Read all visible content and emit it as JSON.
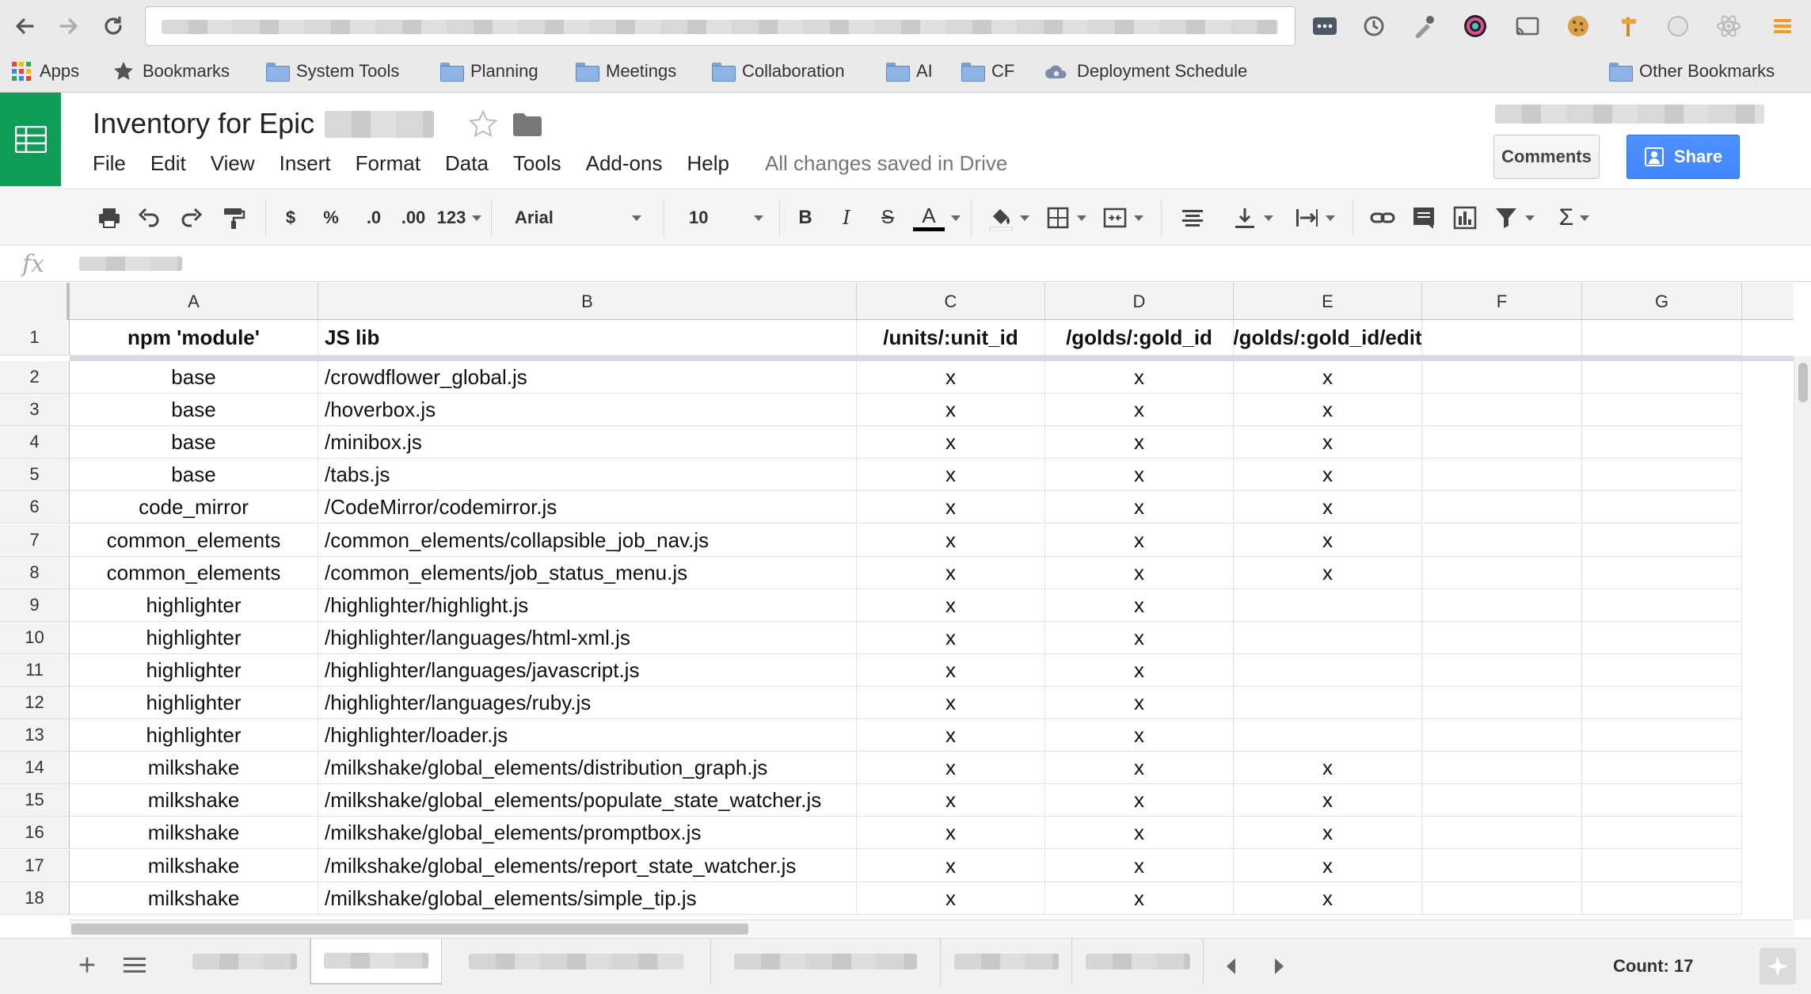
{
  "browser": {
    "bookmarks": [
      {
        "label": "Apps",
        "icon": "apps-grid-icon"
      },
      {
        "label": "Bookmarks",
        "icon": "star-icon"
      },
      {
        "label": "System Tools",
        "icon": "folder-icon"
      },
      {
        "label": "Planning",
        "icon": "folder-icon"
      },
      {
        "label": "Meetings",
        "icon": "folder-icon"
      },
      {
        "label": "Collaboration",
        "icon": "folder-icon"
      },
      {
        "label": "AI",
        "icon": "folder-icon"
      },
      {
        "label": "CF",
        "icon": "folder-icon"
      },
      {
        "label": "Deployment Schedule",
        "icon": "cloud-gear-icon"
      }
    ],
    "other_bookmarks": "Other Bookmarks"
  },
  "doc": {
    "title": "Inventory for Epic",
    "menu": [
      "File",
      "Edit",
      "View",
      "Insert",
      "Format",
      "Data",
      "Tools",
      "Add-ons",
      "Help"
    ],
    "save_status": "All changes saved in Drive",
    "comments_label": "Comments",
    "share_label": "Share"
  },
  "toolbar": {
    "currency": "$",
    "percent": "%",
    "dec_decrease": ".0",
    "dec_increase": ".00",
    "more_formats": "123",
    "font": "Arial",
    "font_size": "10",
    "bold": "B",
    "italic": "I",
    "strike": "S",
    "text_color": "A",
    "sum": "Σ"
  },
  "formula_bar": {
    "fx": "fx"
  },
  "grid": {
    "columns": [
      "A",
      "B",
      "C",
      "D",
      "E",
      "F",
      "G"
    ],
    "header_row": {
      "num": "1",
      "cells": [
        "npm 'module'",
        "JS lib",
        "/units/:unit_id",
        "/golds/:gold_id",
        "/golds/:gold_id/edit",
        "",
        ""
      ]
    },
    "rows": [
      {
        "num": "2",
        "cells": [
          "base",
          "/crowdflower_global.js",
          "x",
          "x",
          "x",
          "",
          ""
        ]
      },
      {
        "num": "3",
        "cells": [
          "base",
          "/hoverbox.js",
          "x",
          "x",
          "x",
          "",
          ""
        ]
      },
      {
        "num": "4",
        "cells": [
          "base",
          "/minibox.js",
          "x",
          "x",
          "x",
          "",
          ""
        ]
      },
      {
        "num": "5",
        "cells": [
          "base",
          "/tabs.js",
          "x",
          "x",
          "x",
          "",
          ""
        ]
      },
      {
        "num": "6",
        "cells": [
          "code_mirror",
          "/CodeMirror/codemirror.js",
          "x",
          "x",
          "x",
          "",
          ""
        ]
      },
      {
        "num": "7",
        "cells": [
          "common_elements",
          "/common_elements/collapsible_job_nav.js",
          "x",
          "x",
          "x",
          "",
          ""
        ]
      },
      {
        "num": "8",
        "cells": [
          "common_elements",
          "/common_elements/job_status_menu.js",
          "x",
          "x",
          "x",
          "",
          ""
        ]
      },
      {
        "num": "9",
        "cells": [
          "highlighter",
          "/highlighter/highlight.js",
          "x",
          "x",
          "",
          "",
          ""
        ]
      },
      {
        "num": "10",
        "cells": [
          "highlighter",
          "/highlighter/languages/html-xml.js",
          "x",
          "x",
          "",
          "",
          ""
        ]
      },
      {
        "num": "11",
        "cells": [
          "highlighter",
          "/highlighter/languages/javascript.js",
          "x",
          "x",
          "",
          "",
          ""
        ]
      },
      {
        "num": "12",
        "cells": [
          "highlighter",
          "/highlighter/languages/ruby.js",
          "x",
          "x",
          "",
          "",
          ""
        ]
      },
      {
        "num": "13",
        "cells": [
          "highlighter",
          "/highlighter/loader.js",
          "x",
          "x",
          "",
          "",
          ""
        ]
      },
      {
        "num": "14",
        "cells": [
          "milkshake",
          "/milkshake/global_elements/distribution_graph.js",
          "x",
          "x",
          "x",
          "",
          ""
        ]
      },
      {
        "num": "15",
        "cells": [
          "milkshake",
          "/milkshake/global_elements/populate_state_watcher.js",
          "x",
          "x",
          "x",
          "",
          ""
        ]
      },
      {
        "num": "16",
        "cells": [
          "milkshake",
          "/milkshake/global_elements/promptbox.js",
          "x",
          "x",
          "x",
          "",
          ""
        ]
      },
      {
        "num": "17",
        "cells": [
          "milkshake",
          "/milkshake/global_elements/report_state_watcher.js",
          "x",
          "x",
          "x",
          "",
          ""
        ]
      },
      {
        "num": "18",
        "cells": [
          "milkshake",
          "/milkshake/global_elements/simple_tip.js",
          "x",
          "x",
          "x",
          "",
          ""
        ]
      }
    ]
  },
  "status": {
    "count": "Count: 17"
  },
  "colors": {
    "sheets_green": "#0f9d58",
    "share_blue": "#4d90fe"
  }
}
